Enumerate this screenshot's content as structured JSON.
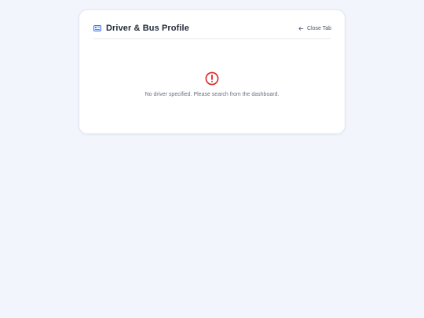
{
  "header": {
    "title": "Driver & Bus Profile",
    "title_icon": "id-card-icon",
    "close_label": "Close Tab",
    "close_icon": "arrow-left-icon"
  },
  "empty_state": {
    "icon": "alert-circle-icon",
    "message": "No driver specified. Please search from the dashboard."
  },
  "colors": {
    "background": "#f2f5fc",
    "card": "#ffffff",
    "accent": "#2563eb",
    "error": "#dc2626",
    "title": "#1f2937",
    "muted": "#6b7280"
  }
}
